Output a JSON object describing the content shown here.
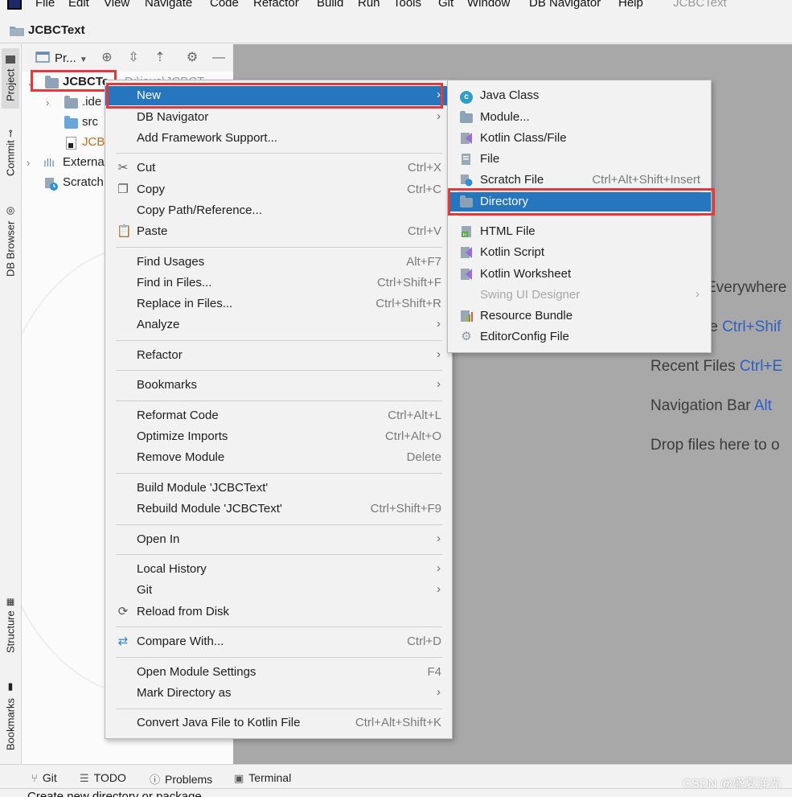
{
  "menubar": {
    "items": [
      "File",
      "Edit",
      "View",
      "Navigate",
      "Code",
      "Refactor",
      "Build",
      "Run",
      "Tools",
      "Git",
      "Window",
      "DB Navigator",
      "Help"
    ],
    "window_title": "JCBCText"
  },
  "navbar": {
    "project": "JCBCText"
  },
  "side_tabs": {
    "project": "Project",
    "commit": "Commit",
    "db_browser": "DB Browser",
    "structure": "Structure",
    "bookmarks": "Bookmarks"
  },
  "project_panel": {
    "view_label": "Pr...",
    "tree": [
      {
        "label": "JCBCTe",
        "extra": "D:\\java\\JCBCT...",
        "type": "module",
        "selected": true
      },
      {
        "label": ".ide",
        "type": "folder"
      },
      {
        "label": "src",
        "type": "source-folder"
      },
      {
        "label": "JCB",
        "type": "file"
      },
      {
        "label": "Externa",
        "type": "libraries"
      },
      {
        "label": "Scratch",
        "type": "scratches"
      }
    ]
  },
  "context_menu": {
    "items": [
      {
        "label": "New",
        "shortcut": "",
        "submenu": true,
        "highlighted": true
      },
      {
        "label": "DB Navigator",
        "shortcut": "",
        "submenu": true
      },
      {
        "label": "Add Framework Support...",
        "shortcut": ""
      },
      {
        "label": "Cut",
        "shortcut": "Ctrl+X",
        "icon": "scissors-icon"
      },
      {
        "label": "Copy",
        "shortcut": "Ctrl+C",
        "icon": "copy-icon"
      },
      {
        "label": "Copy Path/Reference...",
        "shortcut": ""
      },
      {
        "label": "Paste",
        "shortcut": "Ctrl+V",
        "icon": "paste-icon"
      },
      {
        "label": "Find Usages",
        "shortcut": "Alt+F7"
      },
      {
        "label": "Find in Files...",
        "shortcut": "Ctrl+Shift+F"
      },
      {
        "label": "Replace in Files...",
        "shortcut": "Ctrl+Shift+R"
      },
      {
        "label": "Analyze",
        "shortcut": "",
        "submenu": true
      },
      {
        "label": "Refactor",
        "shortcut": "",
        "submenu": true
      },
      {
        "label": "Bookmarks",
        "shortcut": "",
        "submenu": true
      },
      {
        "label": "Reformat Code",
        "shortcut": "Ctrl+Alt+L"
      },
      {
        "label": "Optimize Imports",
        "shortcut": "Ctrl+Alt+O"
      },
      {
        "label": "Remove Module",
        "shortcut": "Delete"
      },
      {
        "label": "Build Module 'JCBCText'",
        "shortcut": ""
      },
      {
        "label": "Rebuild Module 'JCBCText'",
        "shortcut": "Ctrl+Shift+F9"
      },
      {
        "label": "Open In",
        "shortcut": "",
        "submenu": true
      },
      {
        "label": "Local History",
        "shortcut": "",
        "submenu": true
      },
      {
        "label": "Git",
        "shortcut": "",
        "submenu": true
      },
      {
        "label": "Reload from Disk",
        "shortcut": "",
        "icon": "reload-icon"
      },
      {
        "label": "Compare With...",
        "shortcut": "Ctrl+D",
        "icon": "compare-icon"
      },
      {
        "label": "Open Module Settings",
        "shortcut": "F4"
      },
      {
        "label": "Mark Directory as",
        "shortcut": "",
        "submenu": true
      },
      {
        "label": "Convert Java File to Kotlin File",
        "shortcut": "Ctrl+Alt+Shift+K"
      }
    ]
  },
  "new_submenu": {
    "items": [
      {
        "label": "Java Class",
        "icon": "java-class-icon"
      },
      {
        "label": "Module...",
        "icon": "module-icon"
      },
      {
        "label": "Kotlin Class/File",
        "icon": "kotlin-file-icon"
      },
      {
        "label": "File",
        "icon": "file-icon"
      },
      {
        "label": "Scratch File",
        "shortcut": "Ctrl+Alt+Shift+Insert",
        "icon": "scratch-file-icon"
      },
      {
        "label": "Directory",
        "icon": "folder-icon",
        "highlighted": true
      },
      {
        "label": "HTML File",
        "icon": "html-file-icon"
      },
      {
        "label": "Kotlin Script",
        "icon": "kotlin-script-icon"
      },
      {
        "label": "Kotlin Worksheet",
        "icon": "kotlin-worksheet-icon"
      },
      {
        "label": "Swing UI Designer",
        "disabled": true,
        "submenu": true
      },
      {
        "label": "Resource Bundle",
        "icon": "resource-bundle-icon"
      },
      {
        "label": "EditorConfig File",
        "icon": "gear-icon"
      }
    ]
  },
  "editor_hints": [
    {
      "text": "Everywhere",
      "key": ""
    },
    {
      "text": "le ",
      "key": "Ctrl+Shif"
    },
    {
      "text": "Recent Files ",
      "key": "Ctrl+E"
    },
    {
      "text": "Navigation Bar ",
      "key": "Alt"
    },
    {
      "text": "Drop files here to o",
      "key": ""
    }
  ],
  "bottom_tools": [
    "Git",
    "TODO",
    "Problems",
    "Terminal"
  ],
  "watermark": "CSDN @盛夏洋光",
  "status": "Create new directory or package",
  "colors": {
    "highlight": "#2675bf",
    "annotation": "#e23a3a",
    "editor_bg": "#a8a8a8"
  }
}
